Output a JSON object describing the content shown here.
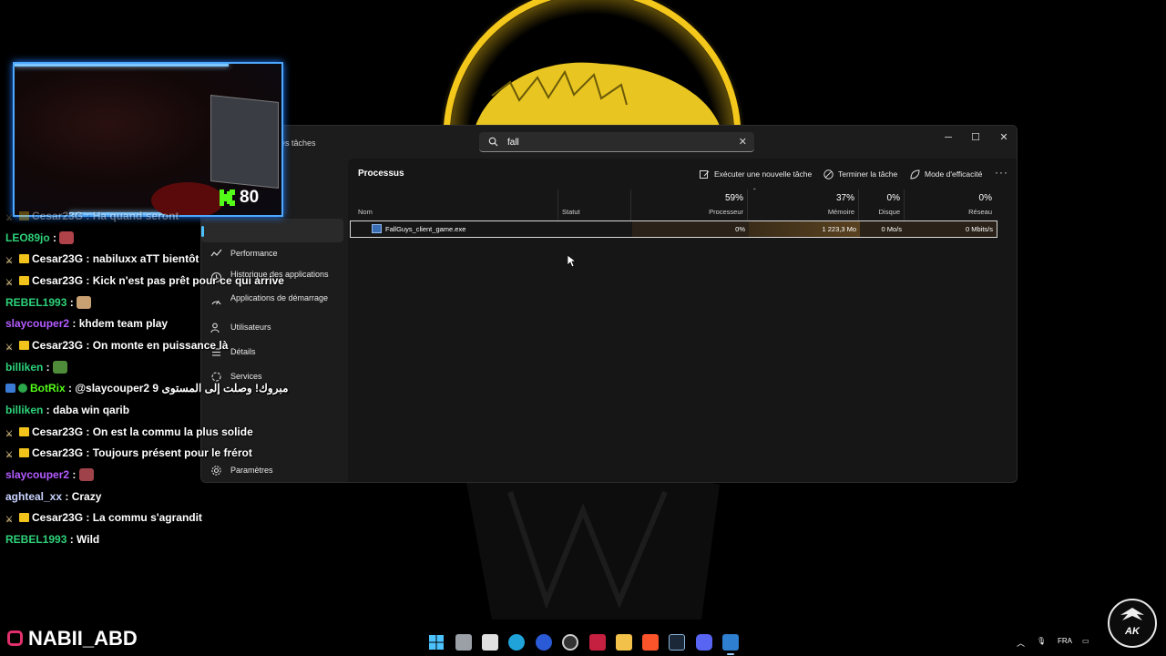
{
  "task_manager": {
    "title": "es tâches",
    "search": {
      "value": "fall"
    },
    "heading": "Processus",
    "toolbar": {
      "new_task": "Exécuter une nouvelle tâche",
      "end_task": "Terminer la tâche",
      "efficiency": "Mode d'efficacité",
      "more": "···"
    },
    "nav": [
      {
        "label": "Performance",
        "icon": "performance-icon"
      },
      {
        "label": "Historique des applications",
        "icon": "history-icon"
      },
      {
        "label": "Applications de démarrage",
        "icon": "startup-icon"
      },
      {
        "label": "Utilisateurs",
        "icon": "users-icon"
      },
      {
        "label": "Détails",
        "icon": "details-icon"
      },
      {
        "label": "Services",
        "icon": "services-icon"
      }
    ],
    "settings_label": "Paramètres",
    "columns": {
      "name": "Nom",
      "status": "Statut",
      "cpu_pct": "59%",
      "cpu_label": "Processeur",
      "mem_pct": "37%",
      "mem_label": "Mémoire",
      "disk_pct": "0%",
      "disk_label": "Disque",
      "net_pct": "0%",
      "net_label": "Réseau"
    },
    "process": {
      "name": "FallGuys_client_game.exe",
      "status": "",
      "cpu": "0%",
      "memory": "1 223,3 Mo",
      "disk": "0 Mo/s",
      "network": "0 Mbits/s"
    }
  },
  "webcam": {
    "viewer_count": "80"
  },
  "chat": [
    {
      "user": "Cesar23G",
      "msg": "Ha quand seront",
      "color": "#ffffff",
      "badges": [
        "sword",
        "crown"
      ]
    },
    {
      "user": "LEO89jo",
      "msg": " ",
      "color": "#2ed27a",
      "badges": [],
      "emote": "#b0424a"
    },
    {
      "user": "Cesar23G",
      "msg": "nabiluxx aTT bientôt",
      "color": "#ffffff",
      "badges": [
        "sword",
        "crown"
      ]
    },
    {
      "user": "Cesar23G",
      "msg": "Kick n'est pas prêt pour ce qui arrive",
      "color": "#ffffff",
      "badges": [
        "sword",
        "crown"
      ]
    },
    {
      "user": "REBEL1993",
      "msg": " ",
      "color": "#2ed27a",
      "badges": [],
      "emote": "#c9a071"
    },
    {
      "user": "slaycouper2",
      "msg": "khdem team play",
      "color": "#b45cff",
      "badges": []
    },
    {
      "user": "Cesar23G",
      "msg": "On monte en puissance là",
      "color": "#ffffff",
      "badges": [
        "sword",
        "crown"
      ]
    },
    {
      "user": "billiken",
      "msg": " ",
      "color": "#2ed27a",
      "badges": [],
      "emote": "#4f8c3a"
    },
    {
      "user": "BotRix",
      "msg": "@slaycouper2 9 مبروك! وصلت إلى المستوى",
      "color": "#53fc18",
      "badges": [
        "bot",
        "check"
      ]
    },
    {
      "user": "billiken",
      "msg": "daba win qarib",
      "color": "#2ed27a",
      "badges": []
    },
    {
      "user": "Cesar23G",
      "msg": "On est la commu la plus solide",
      "color": "#ffffff",
      "badges": [
        "sword",
        "crown"
      ]
    },
    {
      "user": "Cesar23G",
      "msg": "Toujours présent pour le frérot",
      "color": "#ffffff",
      "badges": [
        "sword",
        "crown"
      ]
    },
    {
      "user": "slaycouper2",
      "msg": " ",
      "color": "#b45cff",
      "badges": [],
      "emote": "#a0424a"
    },
    {
      "user": "aghteal_xx",
      "msg": "Crazy",
      "color": "#c9d3ff",
      "badges": []
    },
    {
      "user": "Cesar23G",
      "msg": "La commu s'agrandit",
      "color": "#ffffff",
      "badges": [
        "sword",
        "crown"
      ]
    },
    {
      "user": "REBEL1993",
      "msg": "Wild",
      "color": "#2ed27a",
      "badges": []
    }
  ],
  "channel_name": "NABII_ABD",
  "taskbar": {
    "apps": [
      "windows-start-icon",
      "file-explorer-icon",
      "store-icon",
      "edge-icon",
      "browser-icon",
      "obs-icon",
      "affinity-icon",
      "folder-icon",
      "brave-icon",
      "steam-icon",
      "discord-icon",
      "task-manager-icon"
    ],
    "tray_lang": "FRA"
  },
  "ak_logo": "AK",
  "colors": {
    "accent": "#4cc2ff",
    "gold": "#f2c31b",
    "kick_green": "#53fc18"
  }
}
